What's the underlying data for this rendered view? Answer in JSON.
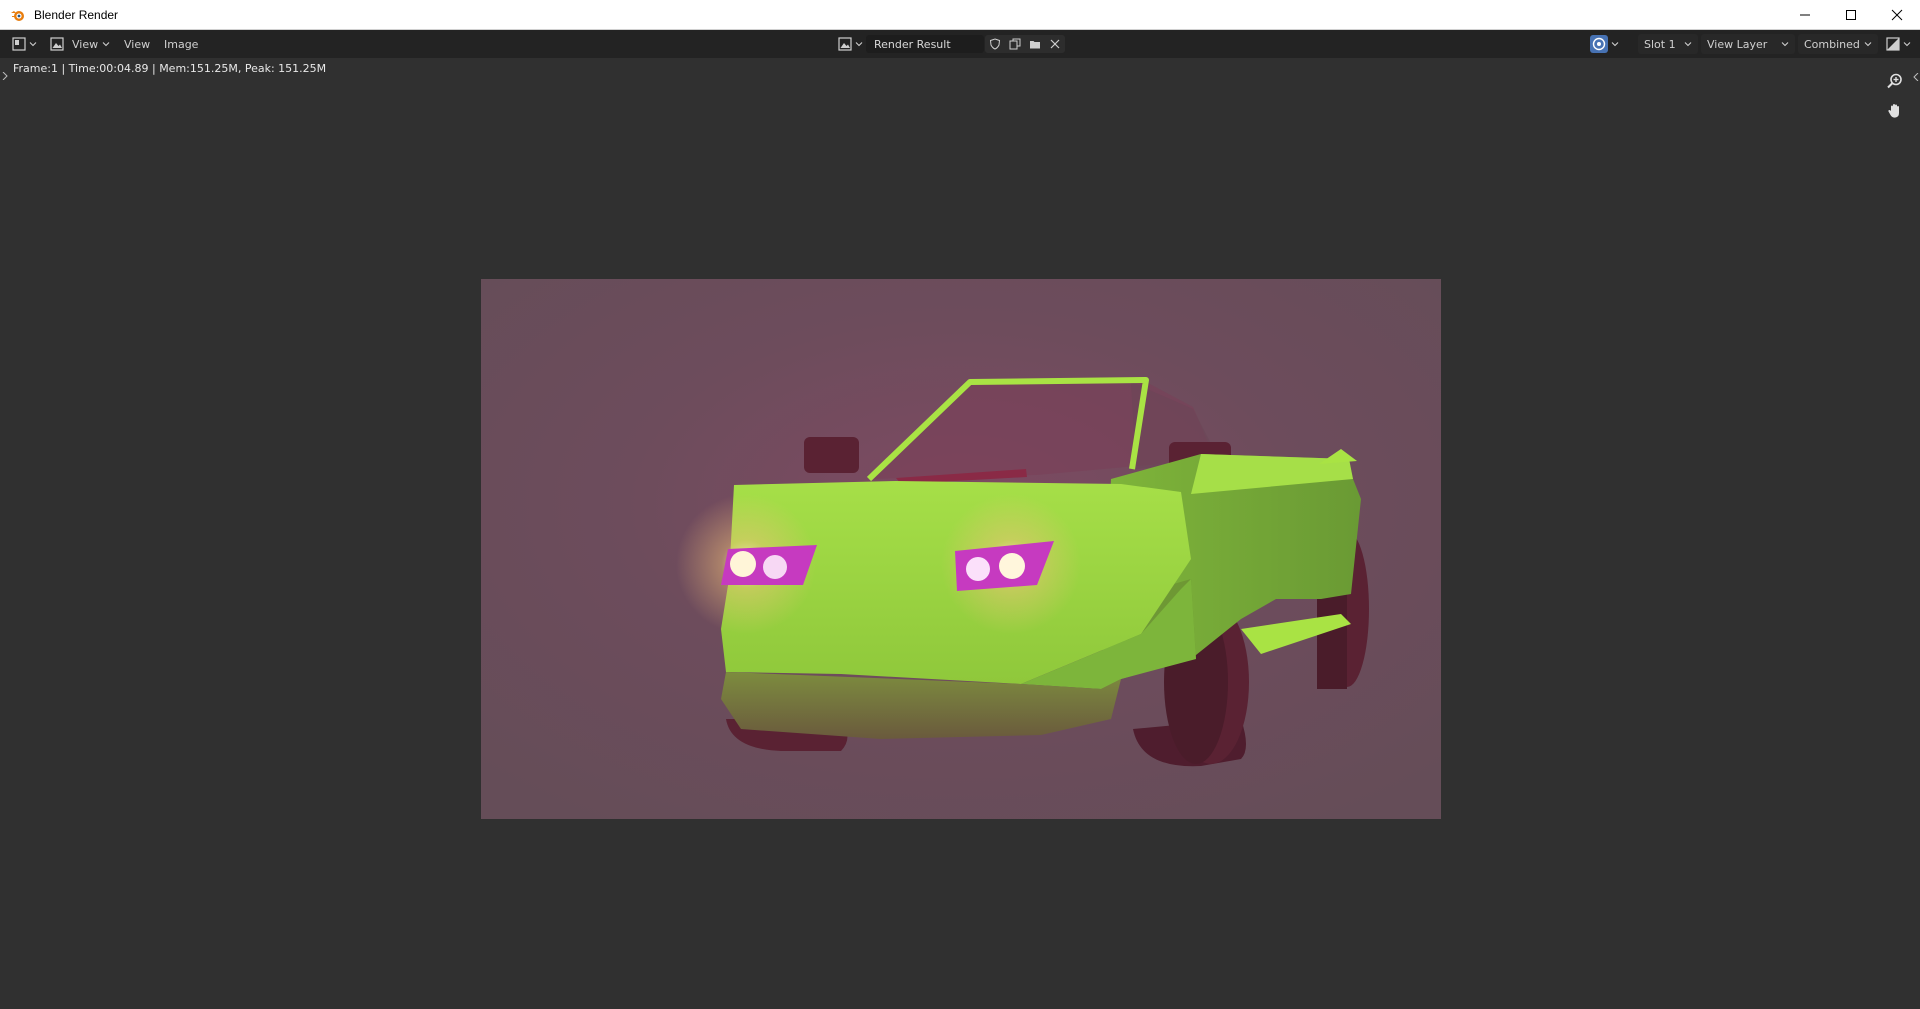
{
  "window": {
    "title": "Blender Render",
    "app_icon": "blender-logo-icon",
    "controls": [
      "minimize-icon",
      "maximize-icon",
      "close-icon"
    ]
  },
  "header": {
    "editor_type_icon": "image-editor-icon",
    "mode_icon": "image-mode-icon",
    "view_dropdown": "View",
    "menu": {
      "view": "View",
      "image": "Image"
    },
    "image_browse_icon": "image-browse-icon",
    "image_name": "Render Result",
    "tool_icons": [
      "fake-user-shield-icon",
      "duplicate-icon",
      "open-folder-icon",
      "close-icon"
    ],
    "overlay_icon": "display-channels-icon",
    "slot": "Slot 1",
    "view_layer": "View Layer",
    "pass": "Combined",
    "channels_icon": "color-channels-icon"
  },
  "info": {
    "text": "Frame:1 | Time:00:04.89 | Mem:151.25M, Peak: 151.25M"
  },
  "viewport": {
    "nav": [
      "zoom-icon",
      "hand-pan-icon"
    ]
  },
  "render": {
    "background_color": "#6a4b58",
    "car_body_color": "#8fcf3c",
    "accent_color": "#a9e344",
    "tire_color": "#5a2233",
    "headlight_color": "#e64fd8"
  }
}
